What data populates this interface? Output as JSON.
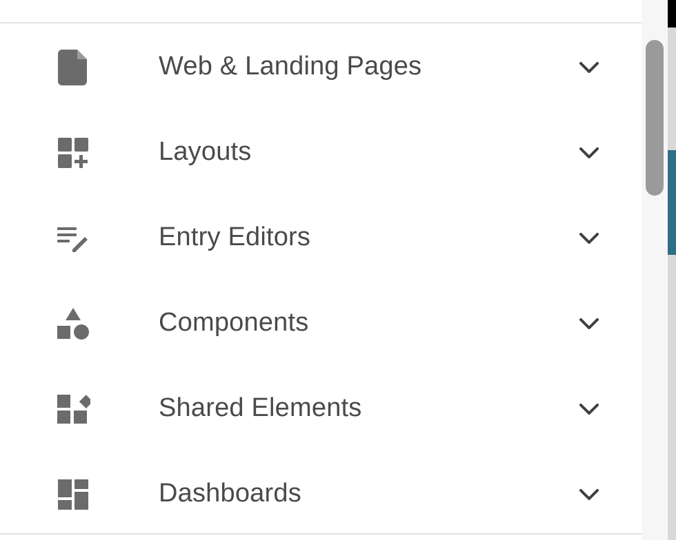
{
  "nav": {
    "items": [
      {
        "label": "Web & Landing Pages",
        "icon": "document-icon"
      },
      {
        "label": "Layouts",
        "icon": "dashboard-add-icon"
      },
      {
        "label": "Entry Editors",
        "icon": "edit-note-icon"
      },
      {
        "label": "Components",
        "icon": "shapes-icon"
      },
      {
        "label": "Shared Elements",
        "icon": "widgets-icon"
      },
      {
        "label": "Dashboards",
        "icon": "dashboard-icon"
      }
    ]
  },
  "colors": {
    "icon": "#6b6b6b",
    "label": "#4a4a4a",
    "chevron": "#3f3f3f",
    "scroll_thumb": "#9a9a9a",
    "accent_edge": "#2e6f87"
  }
}
